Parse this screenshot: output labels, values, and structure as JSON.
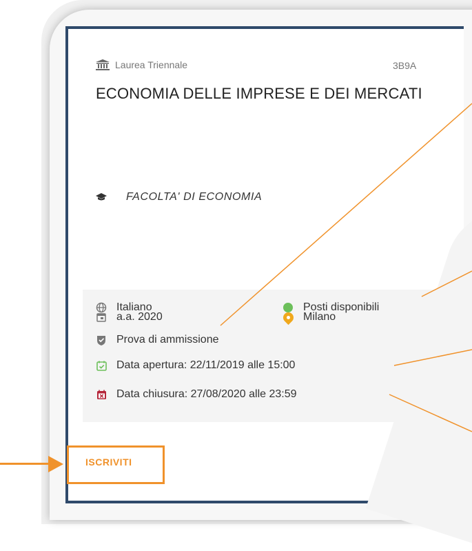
{
  "course": {
    "type_label": "Laurea Triennale",
    "code": "3B9A",
    "title": "ECONOMIA DELLE IMPRESE E DEI MERCATI",
    "faculty": "FACOLTA'  DI  ECONOMIA"
  },
  "info": {
    "language": "Italiano",
    "availability": "Posti disponibili",
    "academic_year": "a.a. 2020",
    "location": "Milano",
    "admission": "Prova di ammissione",
    "opening": "Data apertura: 22/11/2019 alle 15:00",
    "closing": "Data chiusura: 27/08/2020 alle 23:59"
  },
  "actions": {
    "enroll_label": "ISCRIVITI"
  },
  "colors": {
    "accent": "#f0922b",
    "card_border": "#2f4a6b",
    "available": "#6cbf5a",
    "location_pin": "#f0a81c",
    "open_date": "#6cbf5a",
    "close_date": "#b5263a"
  }
}
